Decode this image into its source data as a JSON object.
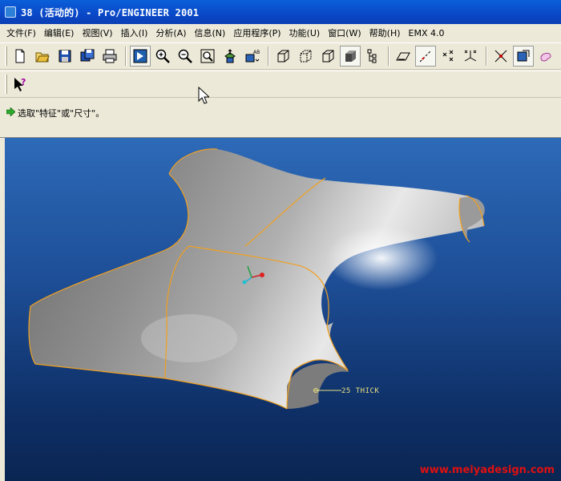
{
  "window": {
    "title": "38 (活动的) - Pro/ENGINEER 2001"
  },
  "menu": [
    {
      "label": "文件(F)"
    },
    {
      "label": "编辑(E)"
    },
    {
      "label": "视图(V)"
    },
    {
      "label": "插入(I)"
    },
    {
      "label": "分析(A)"
    },
    {
      "label": "信息(N)"
    },
    {
      "label": "应用程序(P)"
    },
    {
      "label": "功能(U)"
    },
    {
      "label": "窗口(W)"
    },
    {
      "label": "帮助(H)"
    },
    {
      "label": "EMX 4.0"
    }
  ],
  "toolbar": {
    "file_group": [
      "new-file-icon",
      "open-file-icon",
      "save-icon",
      "save-copy-icon",
      "print-icon"
    ],
    "view_group": [
      "repaint-icon",
      "zoom-in-icon",
      "zoom-out-icon",
      "refit-icon",
      "orient-icon",
      "saved-views-icon"
    ],
    "display_group": [
      "wireframe-icon",
      "hidden-line-icon",
      "no-hidden-icon",
      "shaded-icon",
      "model-tree-icon"
    ],
    "datum_group": [
      "datum-plane-icon",
      "datum-axis-icon",
      "datum-point-icon",
      "coord-sys-icon"
    ],
    "selection_group": [
      "spin-center-icon",
      "select-filter-icon",
      "appearance-icon"
    ],
    "help_button": "whats-this-icon"
  },
  "message": {
    "text": "选取\"特征\"或\"尺寸\"。"
  },
  "viewport": {
    "annotation": "25 THICK",
    "watermark": "www.meiyadesign.com",
    "background_top": "#2d6ab8",
    "background_bottom": "#0a2552",
    "edge_color": "#f0a020"
  }
}
